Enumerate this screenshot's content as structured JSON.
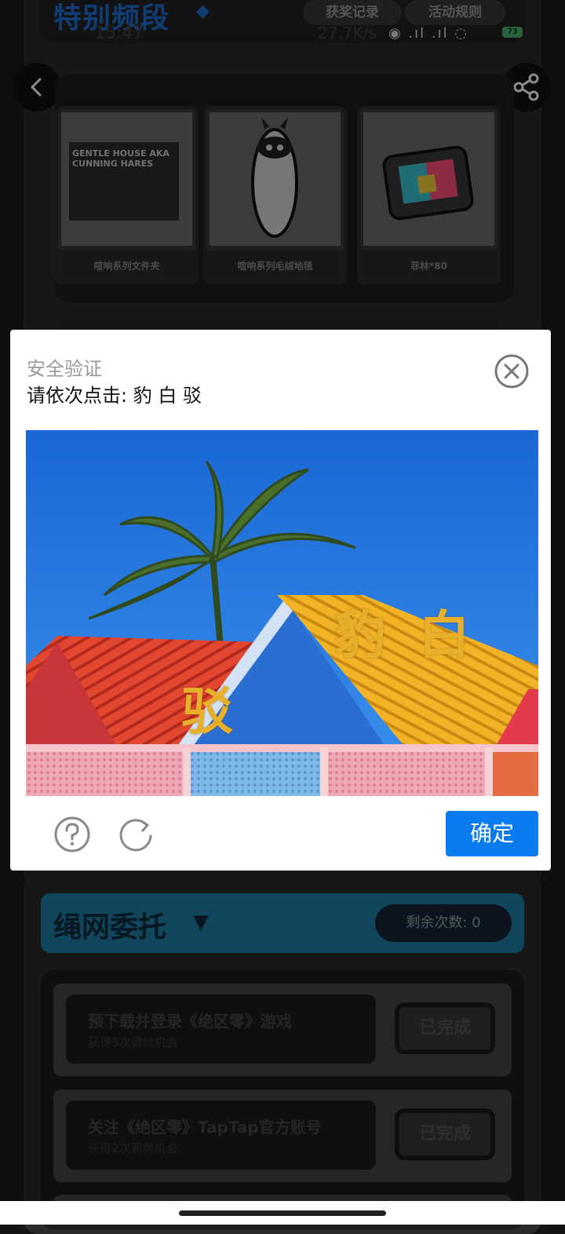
{
  "background_app": {
    "header": {
      "title": "特别频段",
      "awards_button": "获奖记录",
      "rules_button": "活动规则"
    },
    "status_bar": {
      "time": "15:47",
      "speed": "27.7K/s",
      "battery": "73"
    },
    "prizes": [
      {
        "label": "喧响系列文件夹",
        "art_text": "GENTLE HOUSE AKA CUNNING HARES"
      },
      {
        "label": "喧响系列毛绒地毯"
      },
      {
        "label": "菲林*80"
      }
    ],
    "rope_section": {
      "title": "绳网委托",
      "remaining_label": "剩余次数: ",
      "remaining_count": "0"
    },
    "tasks": [
      {
        "title": "预下载并登录《绝区零》游戏",
        "subtitle": "获得3次调频机会",
        "status": "已完成"
      },
      {
        "title": "关注《绝区零》TapTap官方账号",
        "subtitle": "获得2次调频机会",
        "status": "已完成"
      }
    ]
  },
  "dialog": {
    "title": "安全验证",
    "instruction": "请依次点击: 豹 白 驳",
    "captcha_chars": [
      "豹",
      "白",
      "驳"
    ],
    "confirm_label": "确定"
  },
  "colors": {
    "accent": "#0b7cf0",
    "captcha_text": "#e8b02a",
    "sky": "#1c6fd8"
  }
}
